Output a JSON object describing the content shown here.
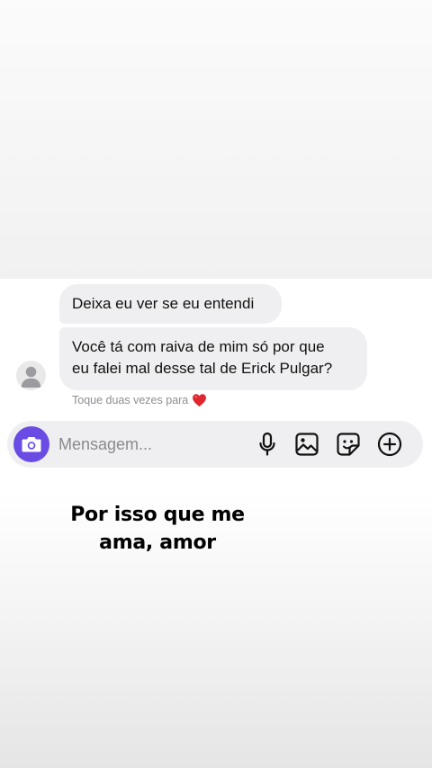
{
  "conversation": {
    "messages": [
      {
        "sender": "other",
        "lines": [
          "Deixa eu ver se eu entendi"
        ]
      },
      {
        "sender": "other",
        "lines": [
          "Você tá com raiva de mim só por que",
          "eu falei mal desse tal de Erick Pulgar?"
        ]
      }
    ],
    "double_tap_hint": "Toque duas vezes para",
    "hint_icon": "heart-icon",
    "hint_icon_color": "#e0262e"
  },
  "composer": {
    "placeholder": "Mensagem...",
    "value": "",
    "accent_color": "#6a4ce4",
    "icons": [
      "camera-icon",
      "microphone-icon",
      "gallery-icon",
      "sticker-icon",
      "plus-icon"
    ]
  },
  "caption": {
    "lines": [
      "Por isso que me",
      "ama, amor"
    ]
  }
}
